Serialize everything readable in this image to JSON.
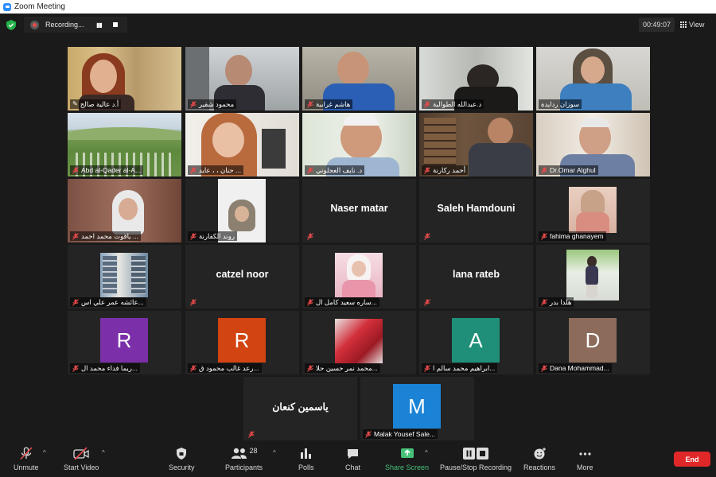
{
  "window": {
    "title": "Zoom Meeting"
  },
  "recording": {
    "label": "Recording..."
  },
  "timer": "00:49:07",
  "view_label": "View",
  "participants": [
    {
      "name": "أ.د عالية صالح",
      "active": true
    },
    {
      "name": "محمود شقير"
    },
    {
      "name": "هاشم غرايبة"
    },
    {
      "name": "د.عبدالله الطوالبة"
    },
    {
      "name": "سوزان ردايدة"
    },
    {
      "name": "Abd al-Qader al-A..."
    },
    {
      "name": "حنان ، ، عايد ..."
    },
    {
      "name": "د. نايف العجلوني"
    },
    {
      "name": "أحمد ركارنة"
    },
    {
      "name": "Dr.Omar Alghul"
    },
    {
      "name": "ياقوت محمد احمد ..."
    },
    {
      "name": "روند الكفارنة"
    },
    {
      "name": "Naser matar"
    },
    {
      "name": "Saleh Hamdouni"
    },
    {
      "name": "fahima ghanayem"
    },
    {
      "name": "عائشه عمر علي اس..."
    },
    {
      "name": "catzel noor"
    },
    {
      "name": "ساره سعيد كامل ال..."
    },
    {
      "name": "lana rateb"
    },
    {
      "name": "هلدا بدر"
    },
    {
      "name": "ريما فداء محمد ال...",
      "avatar": "R",
      "avatar_color": "#7b2fa8"
    },
    {
      "name": "رعد غالب محمود ق...",
      "avatar": "R",
      "avatar_color": "#d24411"
    },
    {
      "name": "محمد نمر حسين حلا..."
    },
    {
      "name": "ابراهيم محمد سالم ا...",
      "avatar": "A",
      "avatar_color": "#1f8f79"
    },
    {
      "name": "Dana Mohammad...",
      "avatar": "D",
      "avatar_color": "#8c6b5b"
    },
    {
      "name": "ياسمين كنعان"
    },
    {
      "name": "Malak Yousef Sale...",
      "avatar": "M",
      "avatar_color": "#1a83d6"
    }
  ],
  "toolbar": {
    "unmute": "Unmute",
    "start_video": "Start Video",
    "security": "Security",
    "participants": "Participants",
    "participants_count": "28",
    "polls": "Polls",
    "chat": "Chat",
    "share_screen": "Share Screen",
    "pause_recording": "Pause/Stop Recording",
    "reactions": "Reactions",
    "more": "More",
    "end": "End"
  },
  "colors": {
    "active_speaker": "#e2dd4a",
    "share": "#47c07a",
    "end": "#e02828"
  }
}
